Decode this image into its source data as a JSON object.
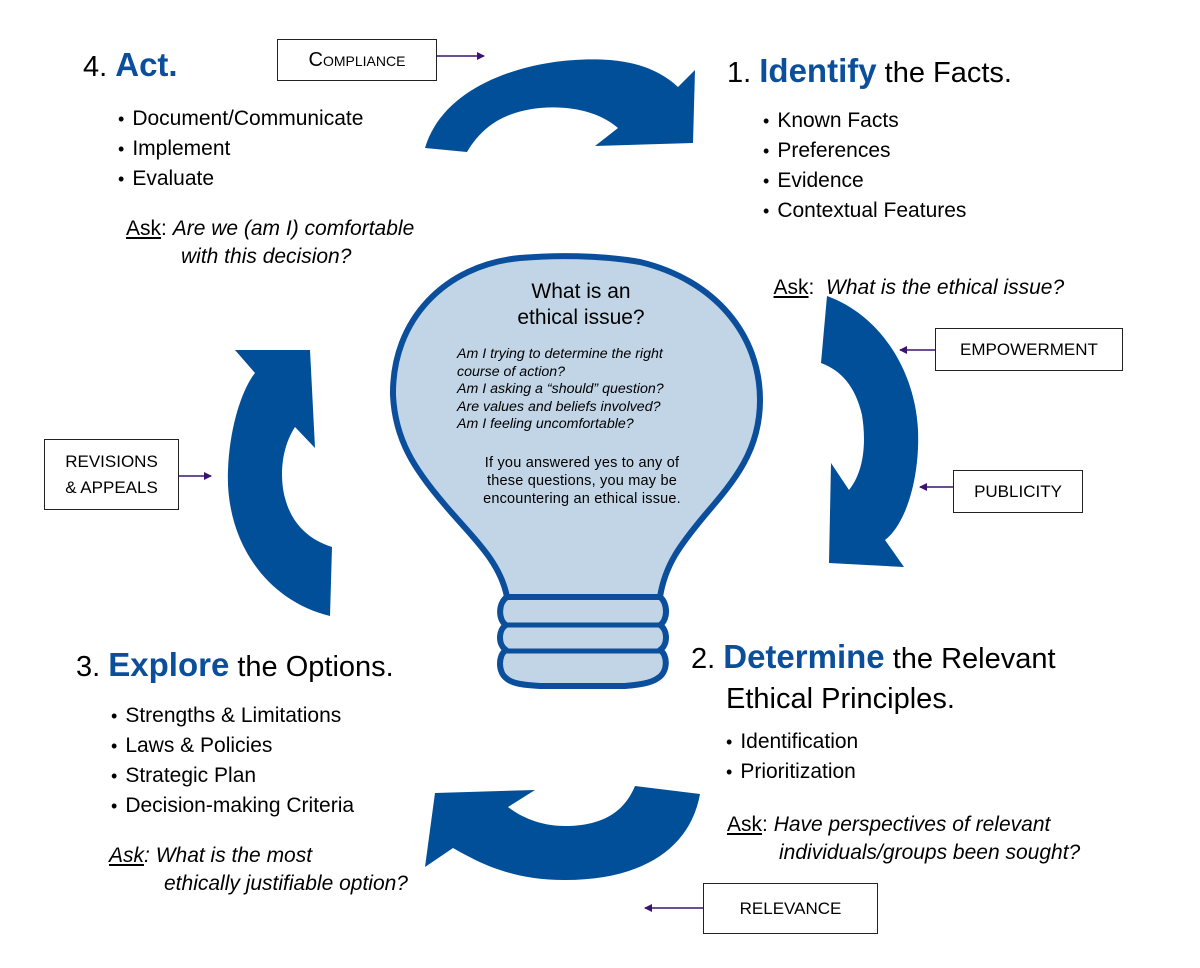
{
  "colors": {
    "arrow_blue": "#004f98",
    "bulb_fill": "#c2d5e6",
    "bulb_outline": "#0b4f9c",
    "keyword_blue": "#0b4f9c",
    "connector_purple": "#3b1370"
  },
  "steps": [
    {
      "number": "1.",
      "keyword": "Identify",
      "rest": " the Facts.",
      "bullets": [
        "Known Facts",
        "Preferences",
        "Evidence",
        "Contextual Features"
      ],
      "ask_label": "Ask",
      "ask_sep": ":  ",
      "ask_question": "What is the ethical issue?"
    },
    {
      "number": "2.",
      "keyword": "Determine",
      "rest": " the Relevant",
      "rest_line2": "Ethical Principles.",
      "bullets": [
        "Identification",
        "Prioritization"
      ],
      "ask_label": "Ask",
      "ask_sep": ": ",
      "ask_question": "Have perspectives of relevant",
      "ask_question_line2": "individuals/groups been sought?"
    },
    {
      "number": "3.",
      "keyword": "Explore",
      "rest": " the Options.",
      "bullets": [
        "Strengths & Limitations",
        "Laws & Policies",
        "Strategic Plan",
        "Decision-making Criteria"
      ],
      "ask_label": "Ask",
      "ask_sep": ": ",
      "ask_question": "What is the most",
      "ask_question_line2": "ethically justifiable option?"
    },
    {
      "number": "4.",
      "keyword": "Act.",
      "rest": "",
      "bullets": [
        "Document/Communicate",
        "Implement",
        "Evaluate"
      ],
      "ask_label": "Ask",
      "ask_sep": ": ",
      "ask_question": "Are we (am I) comfortable",
      "ask_question_line2": "with this decision?"
    }
  ],
  "tags": {
    "compliance": "Compliance",
    "empowerment": "EMPOWERMENT",
    "publicity": "PUBLICITY",
    "relevance": "RELEVANCE",
    "revisions_line1": "REVISIONS",
    "revisions_line2": "& APPEALS"
  },
  "bulb": {
    "title_line1": "What is an",
    "title_line2": "ethical issue?",
    "questions": [
      "Am I trying to determine the right",
      "course of action?",
      "Am I asking a “should” question?",
      "Are values and beliefs involved?",
      "Am I feeling uncomfortable?"
    ],
    "note_lines": [
      "If you answered yes to any of",
      "these questions, you may be",
      "encountering an ethical issue."
    ]
  }
}
